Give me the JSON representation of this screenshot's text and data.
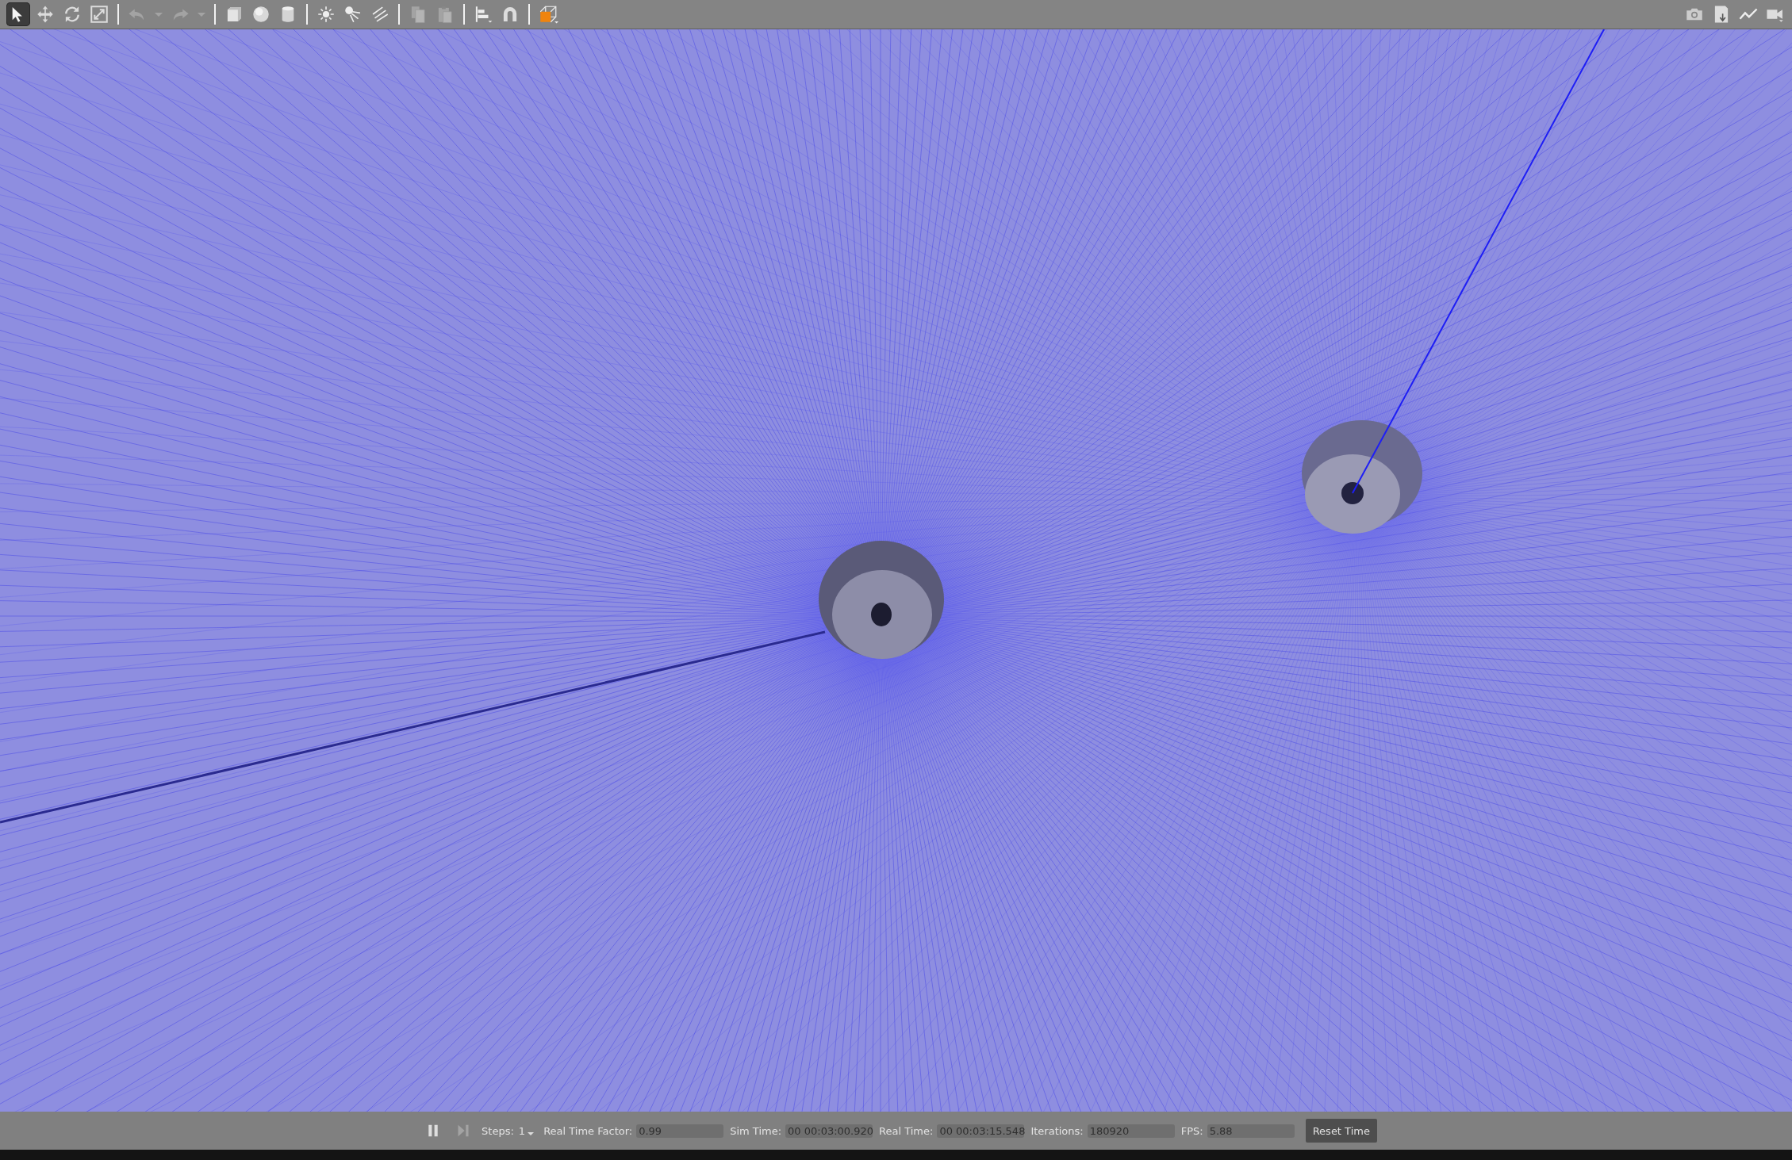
{
  "toolbar": {
    "groups": [
      {
        "items": [
          {
            "kind": "select",
            "selected": true
          },
          {
            "kind": "translate",
            "selected": false
          },
          {
            "kind": "rotate",
            "selected": false
          },
          {
            "kind": "scale",
            "selected": false
          }
        ]
      },
      {
        "items": [
          {
            "kind": "undo",
            "disabled": true
          },
          {
            "kind": "menu-caret",
            "disabled": true
          },
          {
            "kind": "redo",
            "disabled": true
          },
          {
            "kind": "menu-caret",
            "disabled": true
          }
        ]
      },
      {
        "items": [
          {
            "kind": "box"
          },
          {
            "kind": "sphere"
          },
          {
            "kind": "cylinder"
          }
        ]
      },
      {
        "items": [
          {
            "kind": "point-light"
          },
          {
            "kind": "spot-light"
          },
          {
            "kind": "directional-light"
          }
        ]
      },
      {
        "items": [
          {
            "kind": "copy",
            "disabled": true
          },
          {
            "kind": "paste",
            "disabled": true
          }
        ]
      },
      {
        "items": [
          {
            "kind": "align"
          },
          {
            "kind": "snap"
          }
        ]
      },
      {
        "items": [
          {
            "kind": "view-angle"
          }
        ]
      }
    ],
    "right_items": [
      {
        "kind": "screenshot"
      },
      {
        "kind": "log"
      },
      {
        "kind": "plot"
      },
      {
        "kind": "video"
      }
    ]
  },
  "status_bar": {
    "play_button": {
      "kind": "pause"
    },
    "step_button": {
      "disabled": true
    },
    "steps": {
      "label": "Steps:",
      "value": "1"
    },
    "fields": [
      {
        "label": "Real Time Factor:",
        "value": "0.99"
      },
      {
        "label": "Sim Time:",
        "value": "00 00:03:00.920"
      },
      {
        "label": "Real Time:",
        "value": "00 00:03:15.548"
      },
      {
        "label": "Iterations:",
        "value": "180920"
      },
      {
        "label": "FPS:",
        "value": "5.88"
      }
    ],
    "reset_button": "Reset Time"
  }
}
